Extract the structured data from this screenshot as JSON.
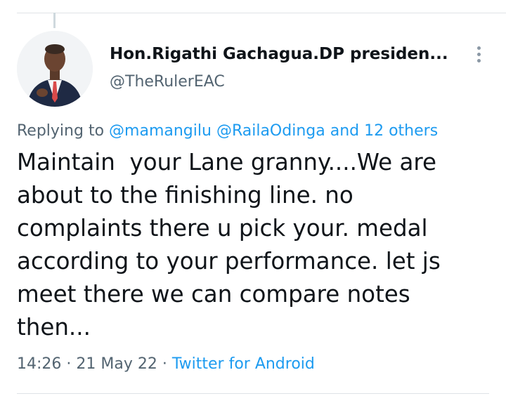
{
  "author": {
    "display_name": "Hon.Rigathi Gachagua.DP presiden...",
    "handle": "@TheRulerEAC",
    "avatar_icon": "profile-photo"
  },
  "reply_context": {
    "prefix": "Replying to ",
    "mentions": [
      "@mamangilu",
      "@RailaOdinga"
    ],
    "others": "and 12 others"
  },
  "tweet": {
    "text": "Maintain  your Lane granny....We are\nabout to the finishing line. no\ncomplaints there u pick your. medal\naccording to your performance. let js\nmeet there we can compare notes\nthen..."
  },
  "meta": {
    "time": "14:26",
    "separator": " · ",
    "date": "21 May 22",
    "source": "Twitter for Android"
  },
  "colors": {
    "link": "#1d9bf0",
    "secondary_text": "#536471",
    "primary_text": "#0f1419",
    "divider": "#dfe3e7"
  },
  "icons": {
    "more": "more-vertical-icon"
  }
}
